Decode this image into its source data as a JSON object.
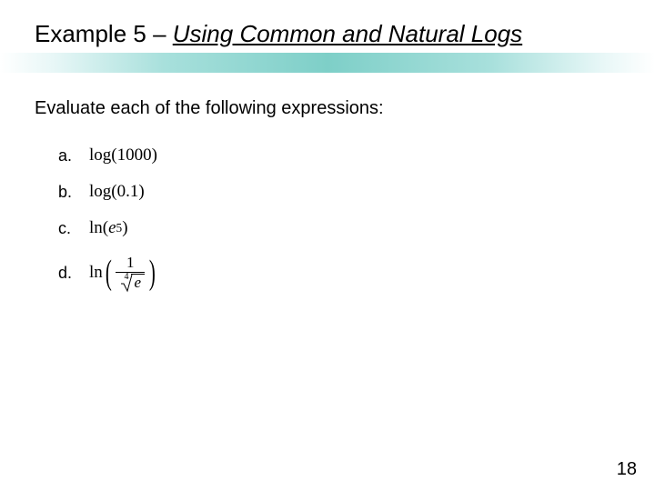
{
  "title": {
    "prefix": "Example 5 – ",
    "emphasis": "Using Common and Natural Logs"
  },
  "instruction": "Evaluate each of the following expressions:",
  "items": [
    {
      "label": "a.",
      "fn": "log",
      "arg": "1000"
    },
    {
      "label": "b.",
      "fn": "log",
      "arg": "0.1"
    },
    {
      "label": "c.",
      "fn": "ln",
      "base": "e",
      "exp": "5"
    },
    {
      "label": "d.",
      "fn": "ln",
      "num": "1",
      "root_index": "4",
      "radicand": "e"
    }
  ],
  "page_number": "18"
}
